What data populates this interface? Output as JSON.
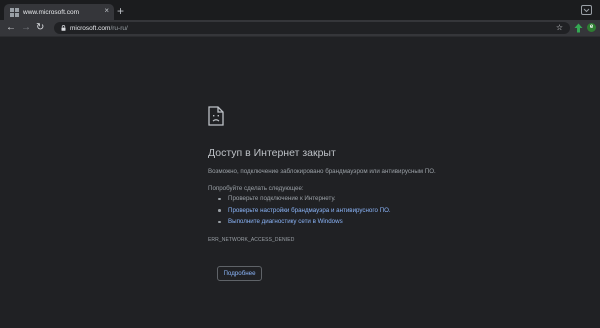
{
  "browser": {
    "tab": {
      "title": "www.microsoft.com",
      "close_glyph": "×",
      "favicon": "microsoft-favicon"
    },
    "new_tab_glyph": "+",
    "toolbar": {
      "back_glyph": "←",
      "forward_glyph": "→",
      "reload_glyph": "↻",
      "url_host": "microsoft.com",
      "url_path": "/ru-ru/",
      "star_glyph": "☆",
      "extensions": [
        "arrow-up-extension-icon",
        "green-badge-extension-icon"
      ],
      "ext2_letter": "e"
    }
  },
  "error_page": {
    "icon": "sad-document-icon",
    "heading": "Доступ в Интернет закрыт",
    "description": "Возможно, подключение заблокировано брандмауэром или антивирусным ПО.",
    "try_label": "Попробуйте сделать следующее:",
    "suggestions": [
      {
        "text": "Проверьте подключение к Интернету.",
        "is_link": false
      },
      {
        "text": "Проверьте настройки брандмауэра и антивирусного ПО.",
        "is_link": true
      },
      {
        "text": "Выполните диагностику сети в Windows",
        "is_link": true
      }
    ],
    "error_code": "ERR_NETWORK_ACCESS_DENIED",
    "details_button": "Подробнее"
  },
  "colors": {
    "page_background": "#202124",
    "tab_background": "#35363a",
    "link": "#8ab4f8",
    "heading": "#bdc1c6",
    "body_text": "#9aa0a6"
  }
}
